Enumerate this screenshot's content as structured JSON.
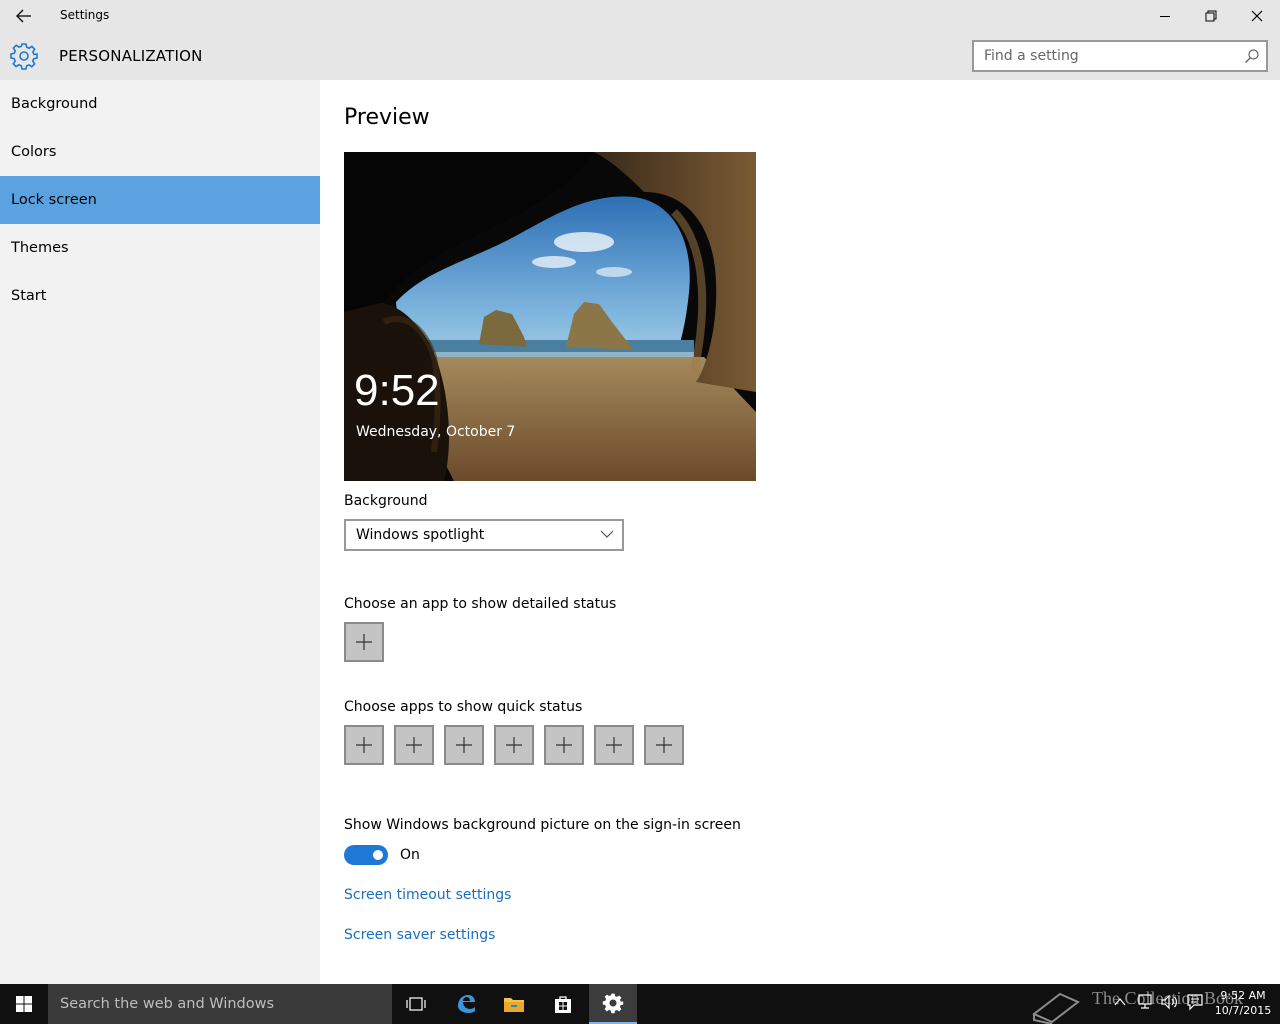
{
  "window": {
    "title": "Settings",
    "minimize_glyph": "─",
    "maximize_glyph": "❐",
    "close_glyph": "✕"
  },
  "header": {
    "title": "PERSONALIZATION",
    "search_placeholder": "Find a setting",
    "accent": "#1e78d6"
  },
  "sidebar": {
    "items": [
      {
        "label": "Background"
      },
      {
        "label": "Colors"
      },
      {
        "label": "Lock screen",
        "active": true
      },
      {
        "label": "Themes"
      },
      {
        "label": "Start"
      }
    ],
    "active_color": "#5aa3e0"
  },
  "main": {
    "preview_heading": "Preview",
    "preview": {
      "time": "9:52",
      "date": "Wednesday, October 7"
    },
    "background_label": "Background",
    "background_value": "Windows spotlight",
    "detailed_status_label": "Choose an app to show detailed status",
    "quick_status_label": "Choose apps to show quick status",
    "signin_label": "Show Windows background picture on the sign-in screen",
    "toggle_state": "On",
    "link_timeout": "Screen timeout settings",
    "link_screensaver": "Screen saver settings"
  },
  "taskbar": {
    "search_text": "Search the web and Windows",
    "watermark": "The Collection Book",
    "clock_time": "9:52 AM",
    "clock_date": "10/7/2015"
  }
}
